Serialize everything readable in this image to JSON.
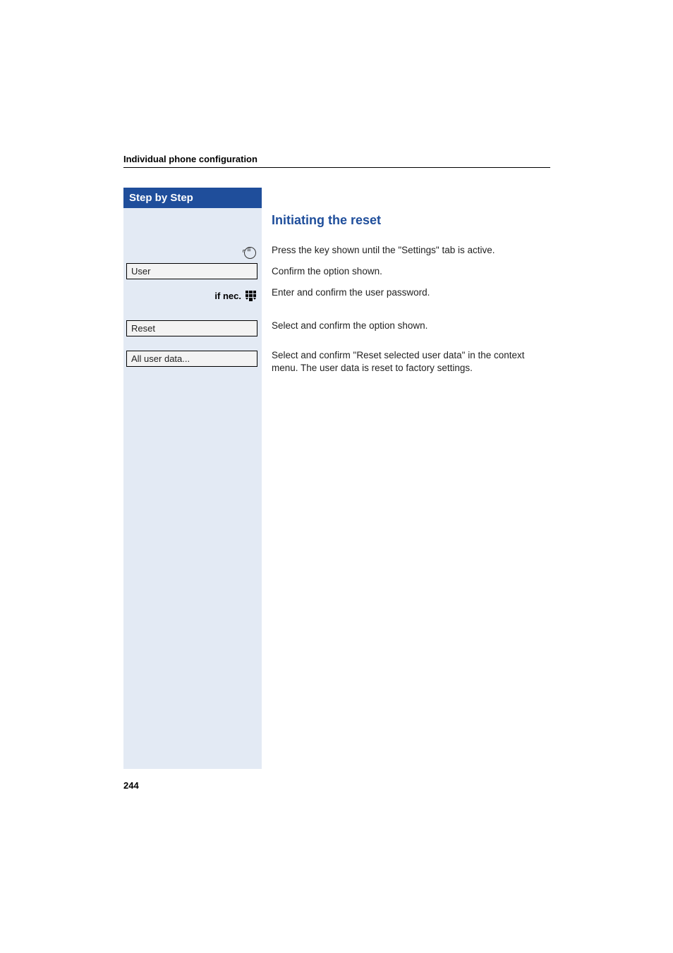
{
  "header": {
    "breadcrumb": "Individual phone configuration"
  },
  "sidebar": {
    "title": "Step by Step",
    "items": {
      "user": "User",
      "if_nec": "if nec.",
      "reset": "Reset",
      "all_user_data": "All user data..."
    }
  },
  "content": {
    "heading": "Initiating the reset",
    "step1": "Press the key shown until the \"Settings\" tab is active.",
    "step2": "Confirm the option shown.",
    "step3": "Enter and confirm the user password.",
    "step4": "Select and confirm the option shown.",
    "step5": "Select and confirm \"Reset selected user data\" in the context menu. The user data is reset to factory settings."
  },
  "footer": {
    "page_number": "244"
  }
}
